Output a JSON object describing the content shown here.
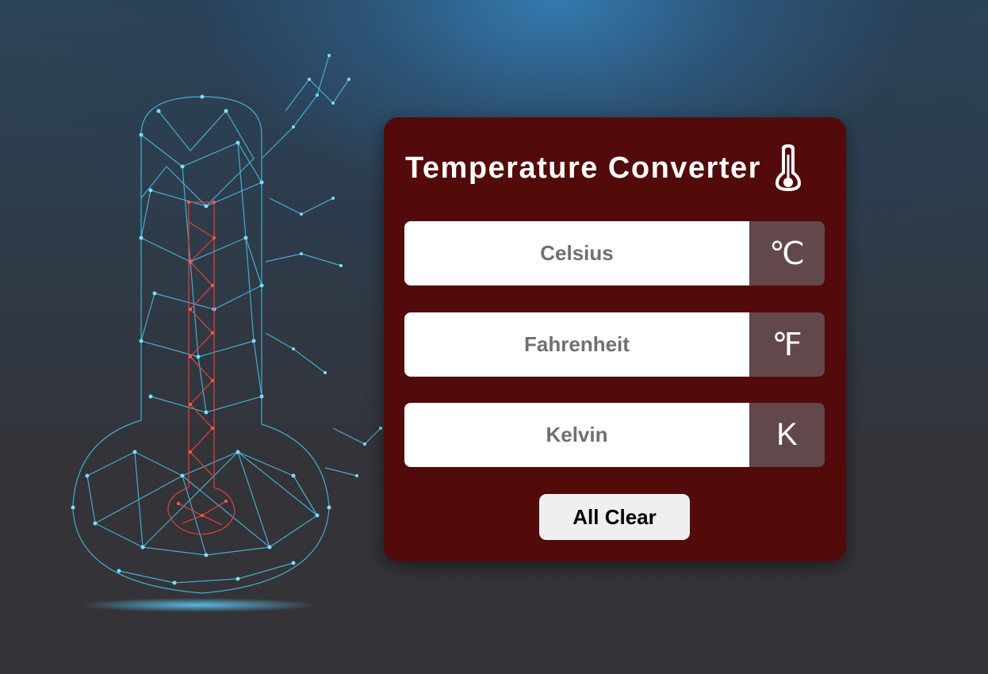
{
  "background": {
    "illustration_icon": "network-thermometer-icon",
    "colors": {
      "top": "#2f7ab3",
      "bottom": "#343438",
      "network_lines": "#49b9e0",
      "mercury": "#e0413a"
    }
  },
  "converter": {
    "title": "Temperature Converter",
    "title_icon": "thermometer-icon",
    "card_color": "#530a0a",
    "unit_color": "#62484a",
    "fields": [
      {
        "placeholder": "Celsius",
        "value": "",
        "unit": "℃"
      },
      {
        "placeholder": "Fahrenheit",
        "value": "",
        "unit": "℉"
      },
      {
        "placeholder": "Kelvin",
        "value": "",
        "unit": "K"
      }
    ],
    "clear_button": "All Clear"
  }
}
